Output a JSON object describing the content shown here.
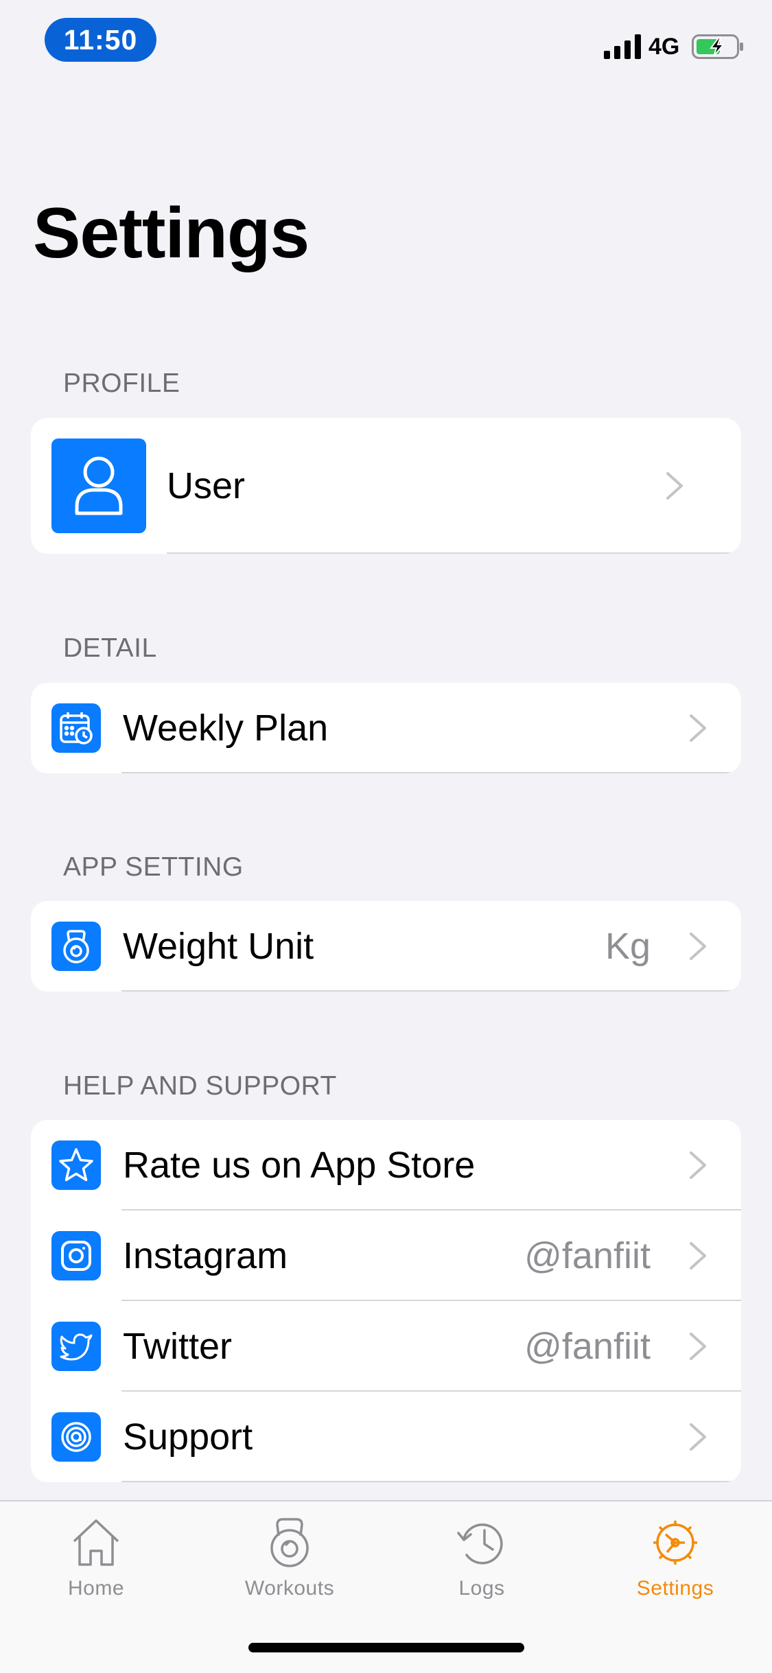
{
  "status_bar": {
    "time": "11:50",
    "network": "4G",
    "pill_color": "#0a63d6",
    "battery_color": "#34c759"
  },
  "page_title": "Settings",
  "accent_color": "#0a7cff",
  "sections": {
    "profile": {
      "header": "PROFILE",
      "user": {
        "label": "User",
        "icon": "person-icon"
      }
    },
    "detail": {
      "header": "DETAIL",
      "weekly_plan": {
        "label": "Weekly Plan",
        "icon": "calendar-clock-icon"
      }
    },
    "app_setting": {
      "header": "APP SETTING",
      "weight_unit": {
        "label": "Weight Unit",
        "value": "Kg",
        "icon": "kettlebell-icon"
      }
    },
    "help": {
      "header": "HELP AND SUPPORT",
      "rate": {
        "label": "Rate us on App Store",
        "icon": "star-icon"
      },
      "instagram": {
        "label": "Instagram",
        "value": "@fanfiit",
        "icon": "instagram-icon"
      },
      "twitter": {
        "label": "Twitter",
        "value": "@fanfiit",
        "icon": "twitter-bird-icon"
      },
      "support": {
        "label": "Support",
        "icon": "at-sign-icon"
      }
    }
  },
  "tab_bar": {
    "home": "Home",
    "workouts": "Workouts",
    "logs": "Logs",
    "settings": "Settings",
    "active_color": "#f58a07",
    "inactive_color": "#8e8e93"
  }
}
